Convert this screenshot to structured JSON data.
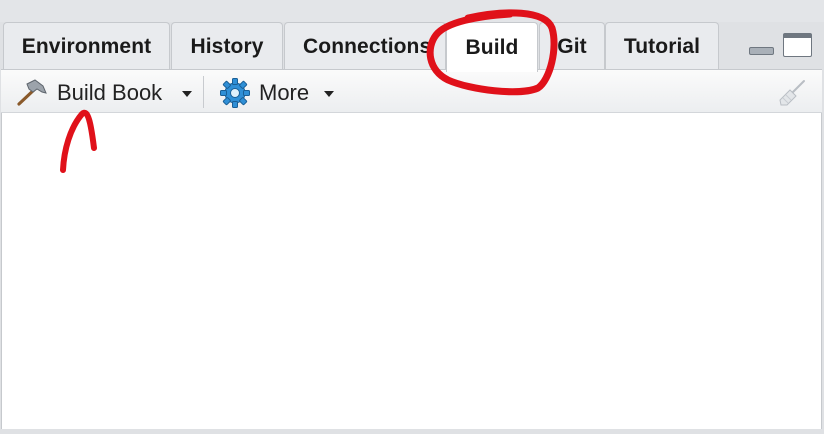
{
  "tabs": [
    {
      "label": "Environment",
      "active": false
    },
    {
      "label": "History",
      "active": false
    },
    {
      "label": "Connections",
      "active": false
    },
    {
      "label": "Build",
      "active": true
    },
    {
      "label": "Git",
      "active": false
    },
    {
      "label": "Tutorial",
      "active": false
    }
  ],
  "toolbar": {
    "build_label": "Build Book",
    "build_icon": "hammer-icon",
    "more_label": "More",
    "more_icon": "gear-icon",
    "clear_icon": "broom-icon"
  },
  "annotation_color": "#e0111a",
  "tab_active_bg": "#ffffff",
  "tab_inactive_bg": "#e9ebee"
}
